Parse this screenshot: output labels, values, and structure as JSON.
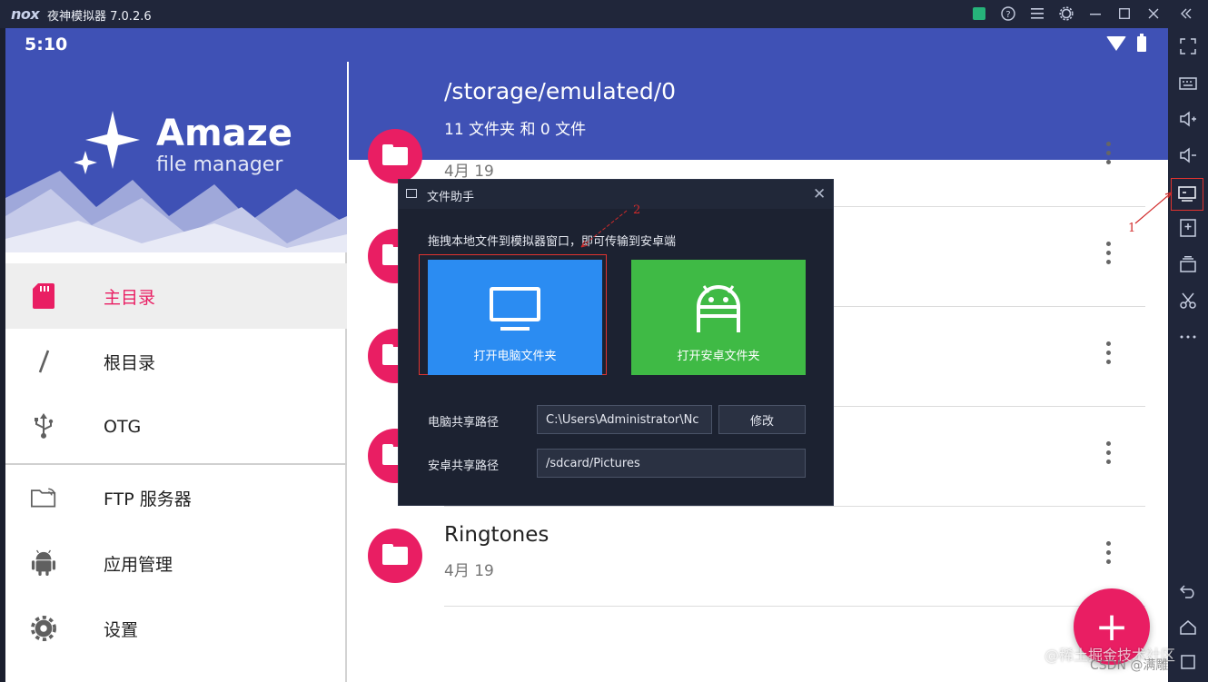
{
  "emulator": {
    "logo": "nox",
    "title": "夜神模拟器 7.0.2.6",
    "controls": [
      "gift-icon",
      "help-icon",
      "menu-icon",
      "settings-icon",
      "minimize-icon",
      "maximize-icon",
      "close-icon",
      "collapse-icon"
    ]
  },
  "statusbar": {
    "time": "5:10"
  },
  "drawer": {
    "brand": "Amaze",
    "brand_sub": "file manager",
    "items": [
      {
        "label": "主目录",
        "icon": "sd-card-icon",
        "active": true
      },
      {
        "label": "根目录",
        "icon": "root-slash-icon",
        "active": false
      },
      {
        "label": "OTG",
        "icon": "usb-icon",
        "active": false
      },
      {
        "label": "FTP 服务器",
        "icon": "ftp-folder-icon",
        "active": false
      },
      {
        "label": "应用管理",
        "icon": "android-icon",
        "active": false
      },
      {
        "label": "设置",
        "icon": "gear-icon",
        "active": false
      }
    ]
  },
  "main": {
    "path": "/storage/emulated/0",
    "summary": "11 文件夹 和 0 文件",
    "files": [
      {
        "name": "",
        "date": "4月 19"
      },
      {
        "name": "",
        "date": ""
      },
      {
        "name": "",
        "date": ""
      },
      {
        "name": "",
        "date": ""
      },
      {
        "name": "Ringtones",
        "date": "4月 19"
      }
    ],
    "fab": "+"
  },
  "dialog": {
    "title": "文件助手",
    "instruction": "拖拽本地文件到模拟器窗口，即可传输到安卓端",
    "pc_button": "打开电脑文件夹",
    "android_button": "打开安卓文件夹",
    "pc_path_label": "电脑共享路径",
    "pc_path_value": "C:\\Users\\Administrator\\Nc",
    "edit_button": "修改",
    "android_path_label": "安卓共享路径",
    "android_path_value": "/sdcard/Pictures"
  },
  "annotations": {
    "marker1": "1",
    "marker2": "2"
  },
  "watermark": "@稀土掘金技术社区",
  "watermark2": "CSDN @满雕",
  "colors": {
    "primary": "#3f51b5",
    "accent": "#e91e63",
    "pc_button": "#2b8cf2",
    "android_button": "#3fba45",
    "dialog_bg": "#1c2231",
    "highlight": "#e0332f"
  }
}
